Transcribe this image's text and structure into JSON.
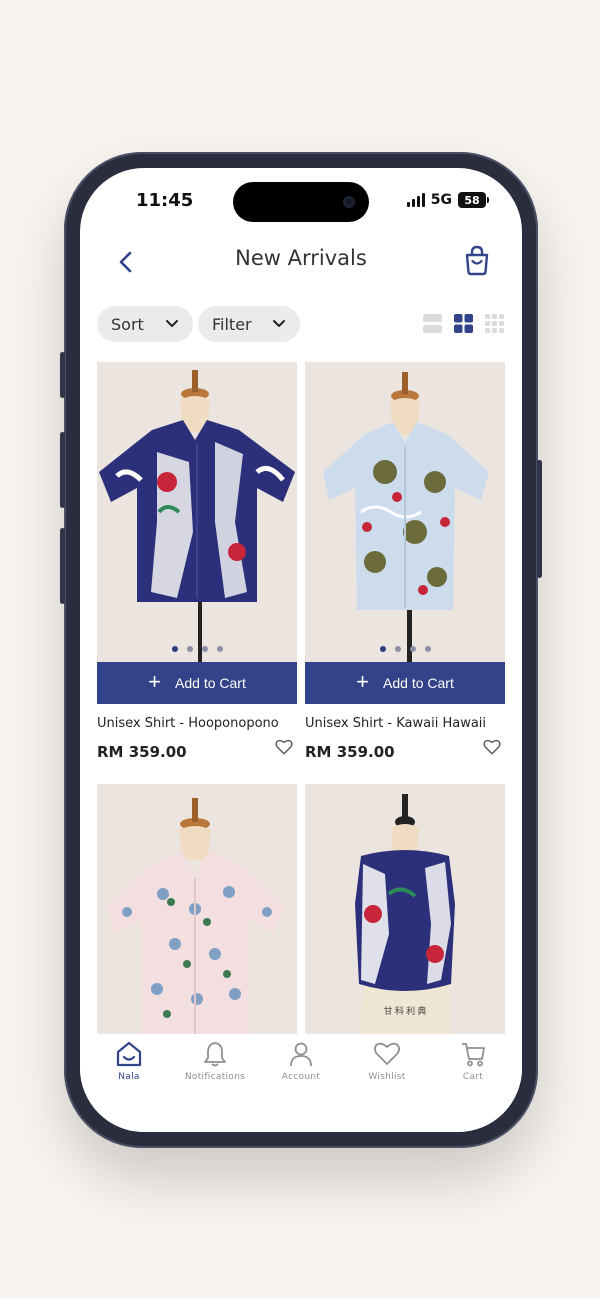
{
  "status_bar": {
    "time": "11:45",
    "network": "5G",
    "battery": "58"
  },
  "header": {
    "title": "New Arrivals"
  },
  "controls": {
    "sort_label": "Sort",
    "filter_label": "Filter",
    "view_modes": [
      "list-view-icon",
      "grid-2-view-icon",
      "grid-3-view-icon"
    ],
    "active_view": "grid-2-view-icon"
  },
  "products": [
    {
      "name": "Unisex Shirt - Hooponopono",
      "price": "RM 359.00",
      "add_label": "Add to Cart",
      "image_dots": 4,
      "active_dot": 1
    },
    {
      "name": "Unisex Shirt - Kawaii Hawaii",
      "price": "RM 359.00",
      "add_label": "Add to Cart",
      "image_dots": 4,
      "active_dot": 1
    },
    {
      "name": "",
      "price": ""
    },
    {
      "name": "",
      "price": ""
    }
  ],
  "tabbar": {
    "items": [
      {
        "label": "Nala",
        "icon": "home-icon",
        "active": true
      },
      {
        "label": "Notifications",
        "icon": "bell-icon",
        "active": false
      },
      {
        "label": "Account",
        "icon": "user-icon",
        "active": false
      },
      {
        "label": "Wishlist",
        "icon": "heart-icon",
        "active": false
      },
      {
        "label": "Cart",
        "icon": "cart-icon",
        "active": false
      }
    ]
  },
  "colors": {
    "accent": "#33438a",
    "background": "#f8f4ef",
    "card_bg": "#ebe4df"
  }
}
